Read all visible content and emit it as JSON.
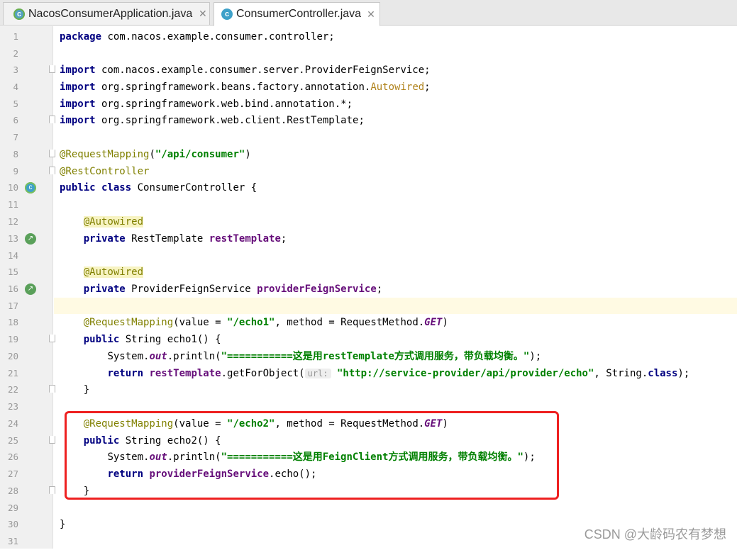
{
  "tabs": [
    {
      "label": "NacosConsumerApplication.java",
      "icon": "c-app-icon",
      "active": false
    },
    {
      "label": "ConsumerController.java",
      "icon": "class-c-icon",
      "active": true
    }
  ],
  "gutter_icons": {
    "class_icon": "c",
    "bean_icon": "↗"
  },
  "code_lines": [
    {
      "n": "1"
    },
    {
      "n": "2"
    },
    {
      "n": "3"
    },
    {
      "n": "4"
    },
    {
      "n": "5"
    },
    {
      "n": "6"
    },
    {
      "n": "7"
    },
    {
      "n": "8"
    },
    {
      "n": "9"
    },
    {
      "n": "10"
    },
    {
      "n": "11"
    },
    {
      "n": "12"
    },
    {
      "n": "13"
    },
    {
      "n": "14"
    },
    {
      "n": "15"
    },
    {
      "n": "16"
    },
    {
      "n": "17"
    },
    {
      "n": "18"
    },
    {
      "n": "19"
    },
    {
      "n": "20"
    },
    {
      "n": "21"
    },
    {
      "n": "22"
    },
    {
      "n": "23"
    },
    {
      "n": "24"
    },
    {
      "n": "25"
    },
    {
      "n": "26"
    },
    {
      "n": "27"
    },
    {
      "n": "28"
    },
    {
      "n": "29"
    },
    {
      "n": "30"
    },
    {
      "n": "31"
    }
  ],
  "code": {
    "l1_kw": "package",
    "l1_rest": " com.nacos.example.consumer.controller;",
    "l3_kw": "import",
    "l3_rest": " com.nacos.example.consumer.server.ProviderFeignService;",
    "l4_kw": "import",
    "l4_rest": " org.springframework.beans.factory.annotation.",
    "l4_ann": "Autowired",
    "l4_end": ";",
    "l5_kw": "import",
    "l5_rest": " org.springframework.web.bind.annotation.*;",
    "l6_kw": "import",
    "l6_rest": " org.springframework.web.client.RestTemplate;",
    "l8_ann": "@RequestMapping",
    "l8_open": "(",
    "l8_str": "\"/api/consumer\"",
    "l8_close": ")",
    "l9_ann": "@RestController",
    "l10_kw": "public class",
    "l10_rest": " ConsumerController {",
    "l12_ann": "@Autowired",
    "l13_kw": "private",
    "l13_type": " RestTemplate ",
    "l13_field": "restTemplate",
    "l13_end": ";",
    "l15_ann": "@Autowired",
    "l16_kw": "private",
    "l16_type": " ProviderFeignService ",
    "l16_field": "providerFeignService",
    "l16_end": ";",
    "l18_ann": "@RequestMapping",
    "l18_a": "(value = ",
    "l18_str": "\"/echo1\"",
    "l18_b": ", method = RequestMethod.",
    "l18_get": "GET",
    "l18_c": ")",
    "l19_kw": "public",
    "l19_rest": " String echo1() {",
    "l20_a": "System.",
    "l20_out": "out",
    "l20_b": ".println(",
    "l20_str": "\"===========这是用restTemplate方式调用服务，带负载均衡。\"",
    "l20_c": ");",
    "l21_kw": "return",
    "l21_sp": " ",
    "l21_field": "restTemplate",
    "l21_a": ".getForObject(",
    "l21_hint": "url:",
    "l21_sp2": " ",
    "l21_str": "\"http://service-provider/api/provider/echo\"",
    "l21_b": ", String.",
    "l21_kw2": "class",
    "l21_c": ");",
    "l22": "}",
    "l24_ann": "@RequestMapping",
    "l24_a": "(value = ",
    "l24_str": "\"/echo2\"",
    "l24_b": ", method = RequestMethod.",
    "l24_get": "GET",
    "l24_c": ")",
    "l25_kw": "public",
    "l25_rest": " String echo2() {",
    "l26_a": "System.",
    "l26_out": "out",
    "l26_b": ".println(",
    "l26_str": "\"===========这是用FeignClient方式调用服务，带负载均衡。\"",
    "l26_c": ");",
    "l27_kw": "return",
    "l27_sp": " ",
    "l27_field": "providerFeignService",
    "l27_a": ".echo();",
    "l28": "}",
    "l30": "}"
  },
  "watermark": "CSDN @大龄码农有梦想",
  "colors": {
    "keyword": "#000080",
    "annotation": "#808000",
    "string": "#008000",
    "field": "#660e7a",
    "highlight_box": "#ee2020",
    "current_line": "#fffae3"
  }
}
